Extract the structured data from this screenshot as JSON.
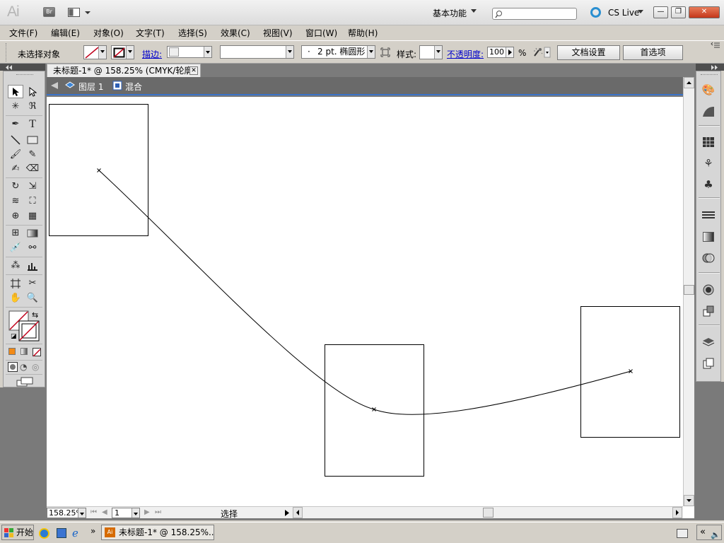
{
  "app": {
    "logo": "Ai",
    "bridge_label": "Br",
    "workspace": "基本功能",
    "search_placeholder": "",
    "cs_live": "CS Live",
    "window_buttons": {
      "minimize": "—",
      "restore": "❐",
      "close": "✕"
    }
  },
  "menu": [
    "文件(F)",
    "编辑(E)",
    "对象(O)",
    "文字(T)",
    "选择(S)",
    "效果(C)",
    "视图(V)",
    "窗口(W)",
    "帮助(H)"
  ],
  "control": {
    "no_selection": "未选择对象",
    "stroke_label": "描边:",
    "brush": "2 pt. 椭圆形",
    "brush_dot": "·",
    "style_label": "样式:",
    "opacity_label": "不透明度:",
    "opacity_value": "100",
    "percent": "%",
    "doc_setup": "文档设置",
    "preferences": "首选项"
  },
  "document": {
    "tab_title": "未标题-1* @ 158.25% (CMYK/轮廓)",
    "layer": "图层 1",
    "group": "混合"
  },
  "status": {
    "zoom": "158.25%",
    "page": "1",
    "status_text": "选择"
  },
  "taskbar": {
    "start": "开始",
    "task": "未标题-1* @ 158.25%...",
    "chevron": "»",
    "expand": "«"
  },
  "colors": {
    "accent_blue": "#3a73c9",
    "stroke_none_red": "#c0001a"
  },
  "canvas_shapes": {
    "rectangles": 3,
    "blend_path_anchor_points": 3
  }
}
